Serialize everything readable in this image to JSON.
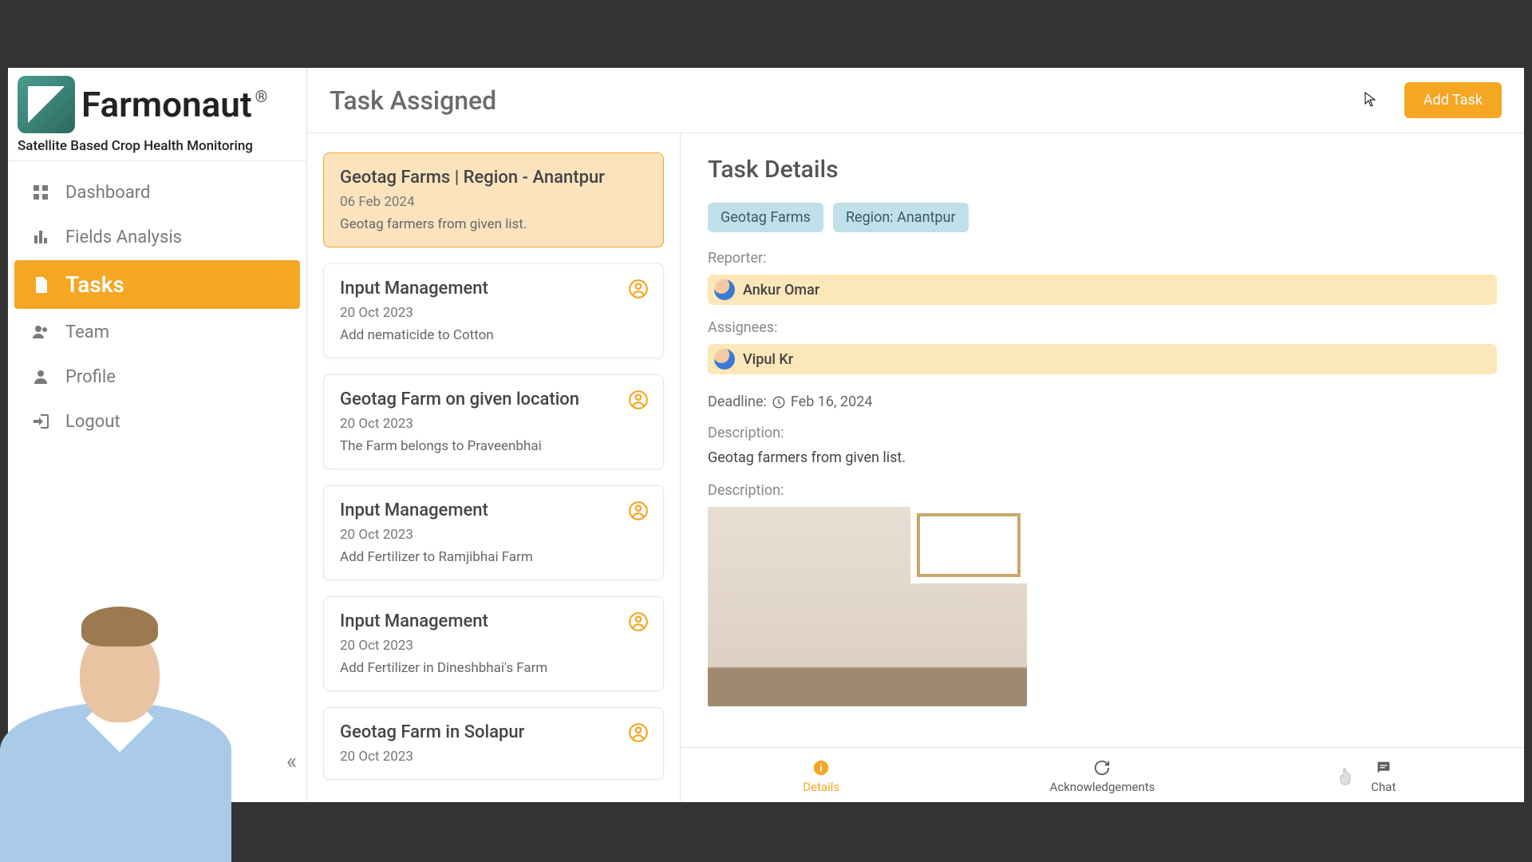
{
  "brand": {
    "name": "Farmonaut",
    "reg": "®",
    "tagline": "Satellite Based Crop Health Monitoring"
  },
  "nav": {
    "dashboard": "Dashboard",
    "fields": "Fields Analysis",
    "tasks": "Tasks",
    "team": "Team",
    "profile": "Profile",
    "logout": "Logout"
  },
  "header": {
    "title": "Task Assigned",
    "add_task": "Add Task"
  },
  "tasks": [
    {
      "title": "Geotag Farms | Region - Anantpur",
      "date": "06 Feb 2024",
      "desc": "Geotag farmers from given list.",
      "selected": true,
      "icon": false
    },
    {
      "title": "Input Management",
      "date": "20 Oct 2023",
      "desc": "Add nematicide to Cotton",
      "selected": false,
      "icon": true
    },
    {
      "title": "Geotag Farm on given location",
      "date": "20 Oct 2023",
      "desc": "The Farm belongs to Praveenbhai",
      "selected": false,
      "icon": true
    },
    {
      "title": "Input Management",
      "date": "20 Oct 2023",
      "desc": "Add Fertilizer to Ramjibhai Farm",
      "selected": false,
      "icon": true
    },
    {
      "title": "Input Management",
      "date": "20 Oct 2023",
      "desc": "Add Fertilizer in Dineshbhai's Farm",
      "selected": false,
      "icon": true
    },
    {
      "title": "Geotag Farm in Solapur",
      "date": "20 Oct 2023",
      "desc": "",
      "selected": false,
      "icon": true
    }
  ],
  "details": {
    "heading": "Task Details",
    "chips": [
      "Geotag Farms",
      "Region: Anantpur"
    ],
    "reporter_label": "Reporter:",
    "reporter_name": "Ankur Omar",
    "assignees_label": "Assignees:",
    "assignee_name": "Vipul Kr",
    "deadline_label": "Deadline:",
    "deadline_value": "Feb 16, 2024",
    "description_label": "Description:",
    "description_text": "Geotag farmers from given list.",
    "description_label2": "Description:"
  },
  "tabs": {
    "details": "Details",
    "ack": "Acknowledgements",
    "chat": "Chat"
  },
  "collapse_glyph": "«"
}
